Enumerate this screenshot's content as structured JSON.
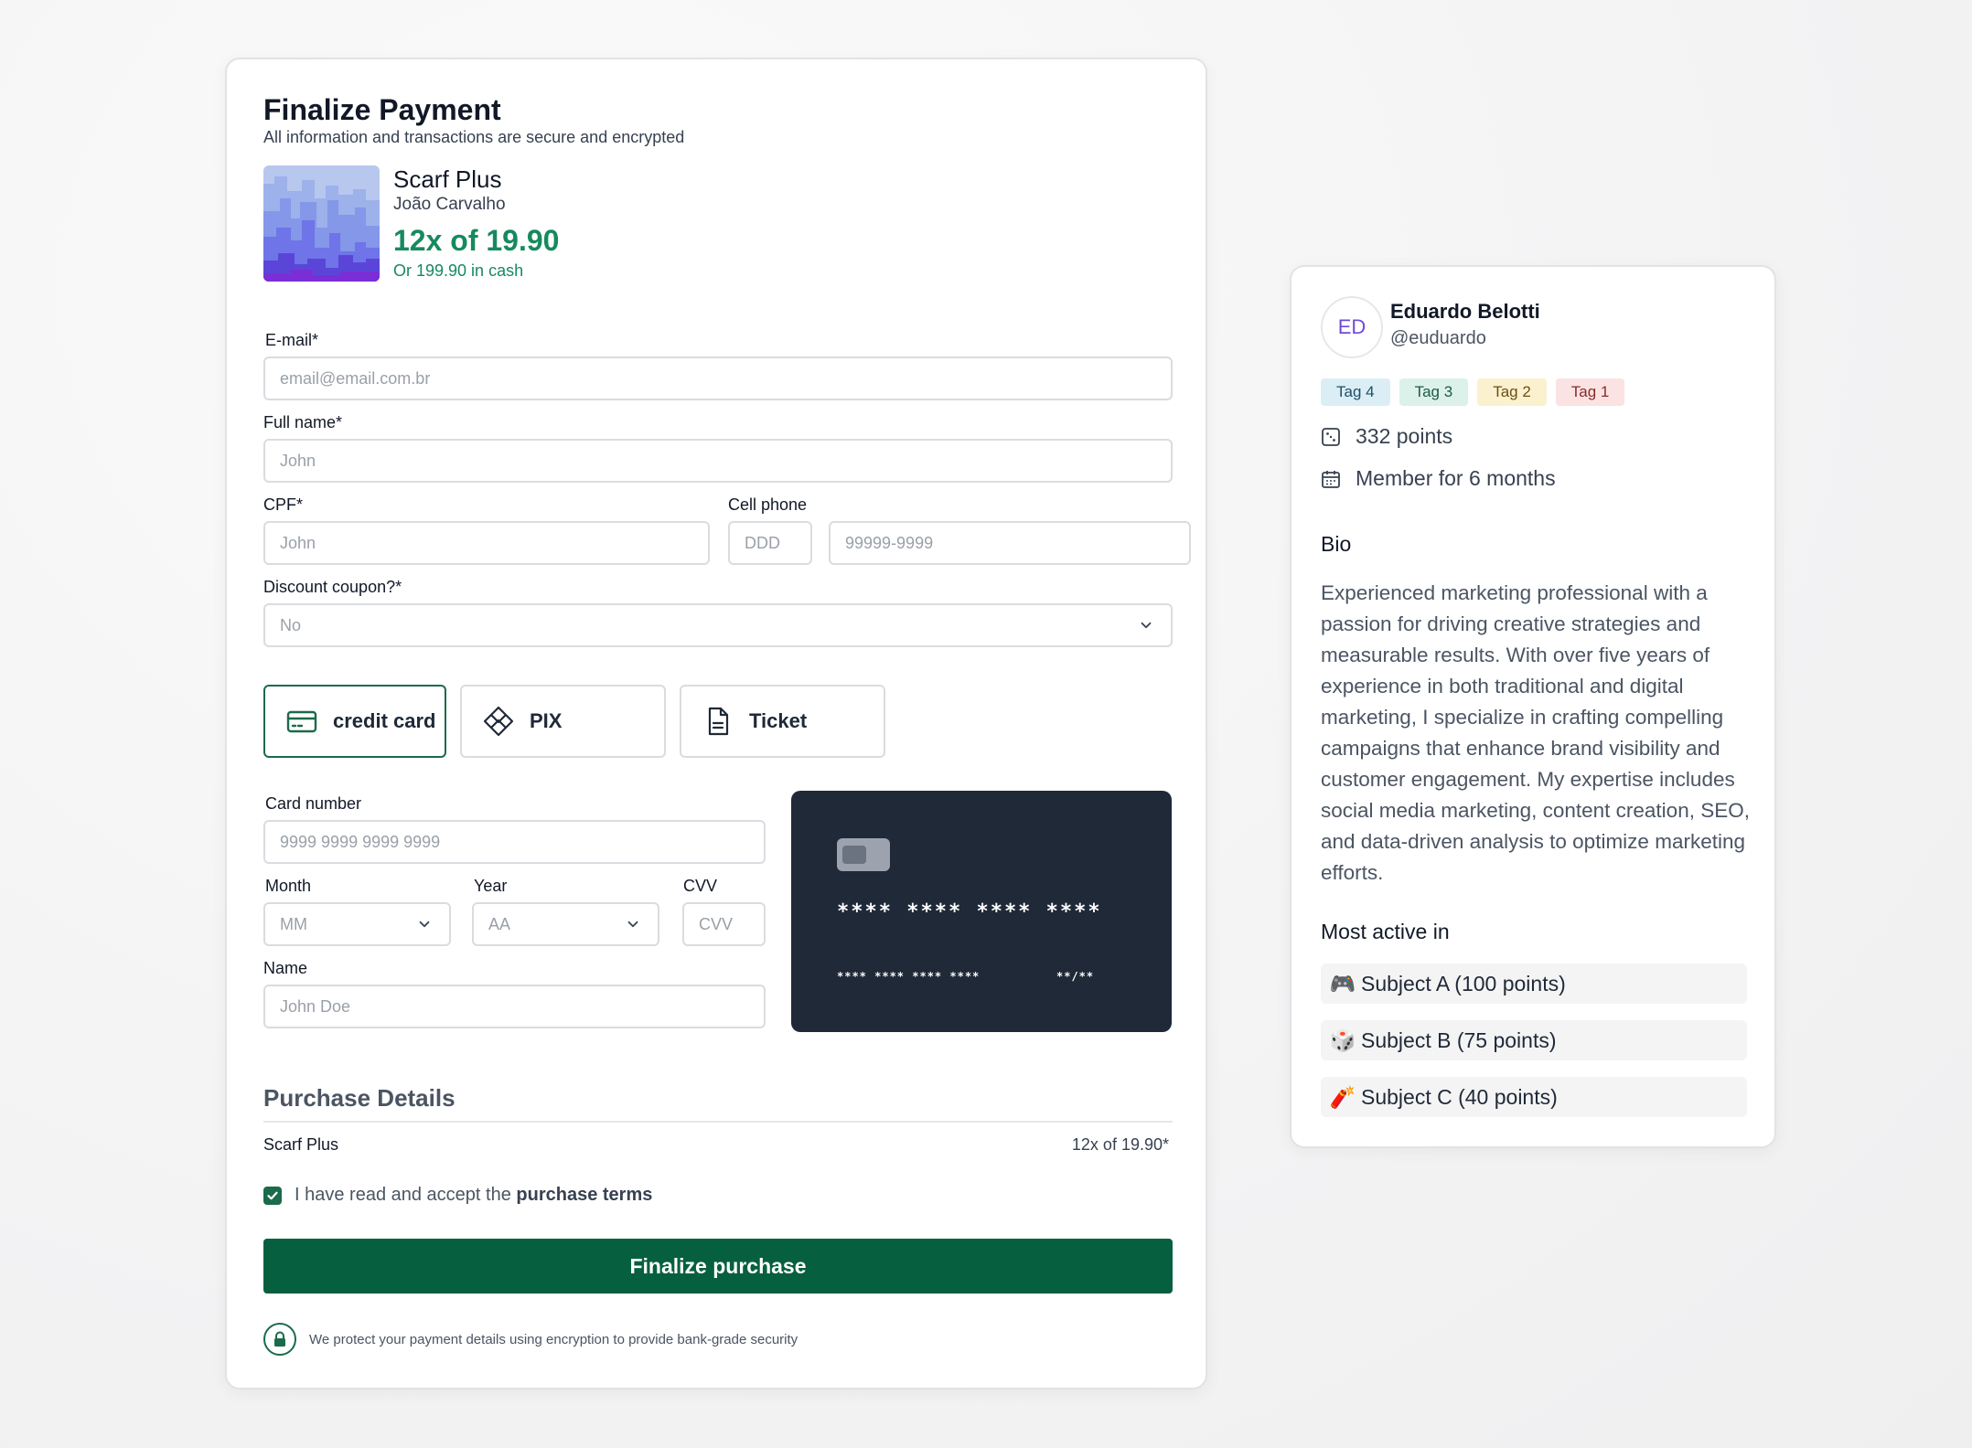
{
  "payment": {
    "title": "Finalize Payment",
    "subtitle": "All information and transactions are secure and encrypted",
    "product": {
      "name": "Scarf Plus",
      "seller": "João Carvalho",
      "installments": "12x of 19.90",
      "cash": "Or 199.90 in cash"
    },
    "form": {
      "email_label": "E-mail*",
      "email_placeholder": "email@email.com.br",
      "fullname_label": "Full name*",
      "fullname_placeholder": "John",
      "cpf_label": "CPF*",
      "cpf_placeholder": "John",
      "phone_label": "Cell phone",
      "ddd_placeholder": "DDD",
      "phone_placeholder": "99999-9999",
      "coupon_label": "Discount coupon?*",
      "coupon_value": "No"
    },
    "methods": [
      {
        "label": "credit card",
        "icon": "credit-card-icon",
        "active": true
      },
      {
        "label": "PIX",
        "icon": "pix-icon",
        "active": false
      },
      {
        "label": "Ticket",
        "icon": "document-icon",
        "active": false
      }
    ],
    "card_form": {
      "number_label": "Card number",
      "number_placeholder": "9999 9999 9999 9999",
      "month_label": "Month",
      "month_placeholder": "MM",
      "year_label": "Year",
      "year_placeholder": "AA",
      "cvv_label": "CVV",
      "cvv_placeholder": "CVV",
      "name_label": "Name",
      "name_placeholder": "John Doe"
    },
    "card_preview": {
      "number": "**** **** **** ****",
      "small_number": "**** **** **** ****",
      "expiry": "**/**"
    },
    "details": {
      "title": "Purchase Details",
      "item": "Scarf Plus",
      "value": "12x of 19.90*"
    },
    "terms_prefix": "I have read and accept the",
    "terms_link": "purchase terms",
    "finalize_label": "Finalize purchase",
    "security_note": "We protect your payment details using encryption to provide bank-grade security"
  },
  "profile": {
    "initials": "ED",
    "name": "Eduardo Belotti",
    "handle": "@euduardo",
    "tags": [
      {
        "label": "Tag 4",
        "bg": "#dbeef5",
        "color": "#1e4e6b"
      },
      {
        "label": "Tag 3",
        "bg": "#dcf1ea",
        "color": "#1f5a44"
      },
      {
        "label": "Tag 2",
        "bg": "#fbf1cf",
        "color": "#6b4f12"
      },
      {
        "label": "Tag 1",
        "bg": "#fbe3e3",
        "color": "#8a2a2a"
      }
    ],
    "points": "332 points",
    "member": "Member for 6 months",
    "bio_title": "Bio",
    "bio": "Experienced marketing professional with a passion for driving creative strategies and measurable results. With over five years of experience in both traditional and digital marketing, I specialize in crafting compelling campaigns that enhance brand visibility and customer engagement. My expertise includes social media marketing, content creation, SEO, and data-driven analysis to optimize marketing efforts.",
    "active_title": "Most active in",
    "subjects": [
      {
        "emoji": "🎮",
        "label": "Subject A (100 points)"
      },
      {
        "emoji": "🎲",
        "label": "Subject B (75 points)"
      },
      {
        "emoji": "🧨",
        "label": "Subject C (40 points)"
      }
    ]
  },
  "colors": {
    "accent": "#06603f",
    "price_green": "#168a5e",
    "card_dark": "#1f2937"
  }
}
